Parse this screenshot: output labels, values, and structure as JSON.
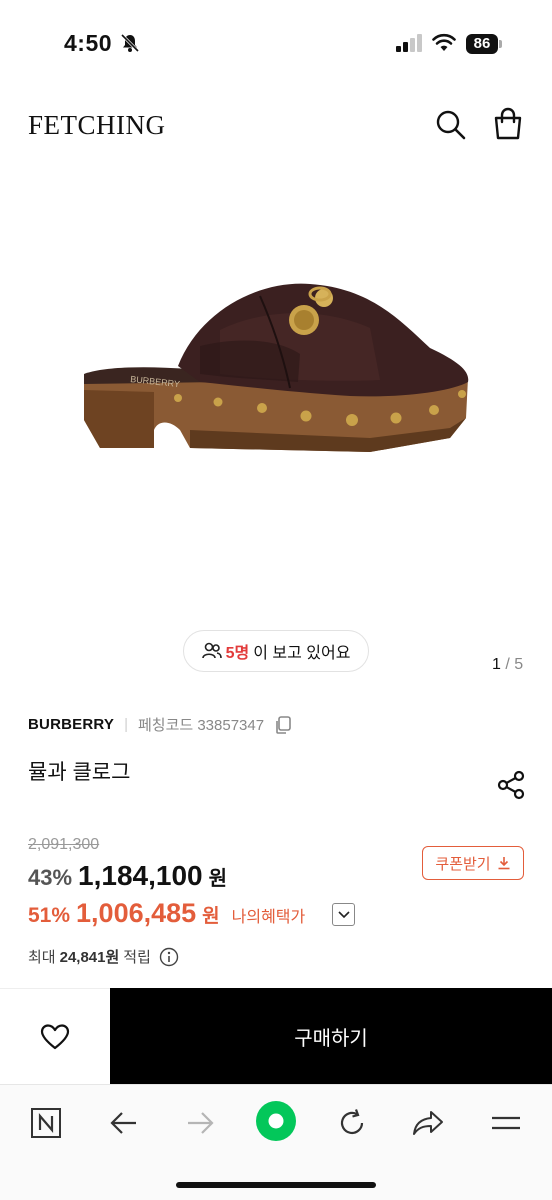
{
  "status_bar": {
    "time": "4:50",
    "battery": "86"
  },
  "header": {
    "logo": "FETCHING"
  },
  "gallery": {
    "viewers_count": "5명",
    "viewers_text": "이 보고 있어요",
    "current": "1",
    "total": "/ 5"
  },
  "product": {
    "brand": "BURBERRY",
    "code_label": "페칭코드 33857347",
    "name": "뮬과 클로그"
  },
  "price": {
    "original": "2,091,300",
    "discount_rate": "43%",
    "sale_price": "1,184,100",
    "won": "원",
    "coupon_label": "쿠폰받기",
    "my_rate": "51%",
    "my_price": "1,006,485",
    "my_won": "원",
    "my_label": "나의혜택가",
    "points_prefix": "최대",
    "points_value": "24,841원",
    "points_suffix": "적립"
  },
  "actions": {
    "buy_label": "구매하기"
  },
  "colors": {
    "accent": "#e35d3b",
    "viewers": "#e23b3b",
    "buy_bg": "#000000",
    "naver_green": "#03c75a"
  },
  "icons": [
    "bell-slash-icon",
    "signal-icon",
    "wifi-icon",
    "search-icon",
    "shopping-bag-icon",
    "people-icon",
    "copy-icon",
    "share-icon",
    "download-icon",
    "chevron-down-icon",
    "info-icon",
    "heart-icon",
    "naver-n-icon",
    "back-arrow-icon",
    "forward-arrow-icon",
    "green-dot-icon",
    "refresh-icon",
    "share-arrow-icon",
    "menu-icon"
  ]
}
